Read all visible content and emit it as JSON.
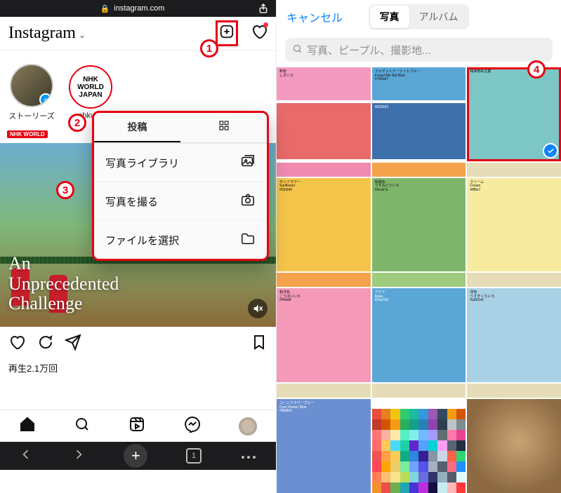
{
  "left": {
    "statusbar": {
      "url": "instagram.com"
    },
    "header": {
      "logo": "Instagram"
    },
    "stories": {
      "your_story_label": "ストーリーズ",
      "item2_label": "nhkwor"
    },
    "dropdown": {
      "tab_posts": "投稿",
      "menu": {
        "library": "写真ライブラリ",
        "take_photo": "写真を撮る",
        "choose_file": "ファイルを選択"
      }
    },
    "feed": {
      "source_badge": "NHK WORLD",
      "overlay_title": "An\nUnprecedented\nChallenge",
      "views": "再生2.1万回"
    },
    "browserbar": {
      "tab_count": "1"
    }
  },
  "right": {
    "header": {
      "cancel": "キャンセル",
      "seg_photos": "写真",
      "seg_albums": "アルバム"
    },
    "search": {
      "placeholder": "写真、ピープル、撮影地..."
    },
    "cells": {
      "c0": "和色\nしきいろ",
      "c1": "フォゲットミーナットブルー\nForget Me Not Blue\n#7bb0d7",
      "c2": "和綿色彩企業",
      "c4": "#053033",
      "c7": {
        "title": "サンフラワー\nSunflower\n#f2b540"
      },
      "c9": {
        "title": "和風色\nうすみどりいろ\n#9ecb7e"
      },
      "c11": {
        "title": "クリーム\nCream\n#fff8e7"
      },
      "c12": {
        "title": "和洋色\nこうばいいろ\n#f49abf"
      },
      "c13": {
        "title": "アクア\nAqua\n#5aa7d6"
      },
      "c14": {
        "title": "洋色\nうすぎくらいろ\n#a9d1e6"
      },
      "c15": {
        "title": "コーンフラワーブルー\nCorn Flower Blue\n#6b8fd1"
      }
    }
  },
  "annotations": {
    "a1": "1",
    "a2": "2",
    "a3": "3",
    "a4": "4"
  }
}
